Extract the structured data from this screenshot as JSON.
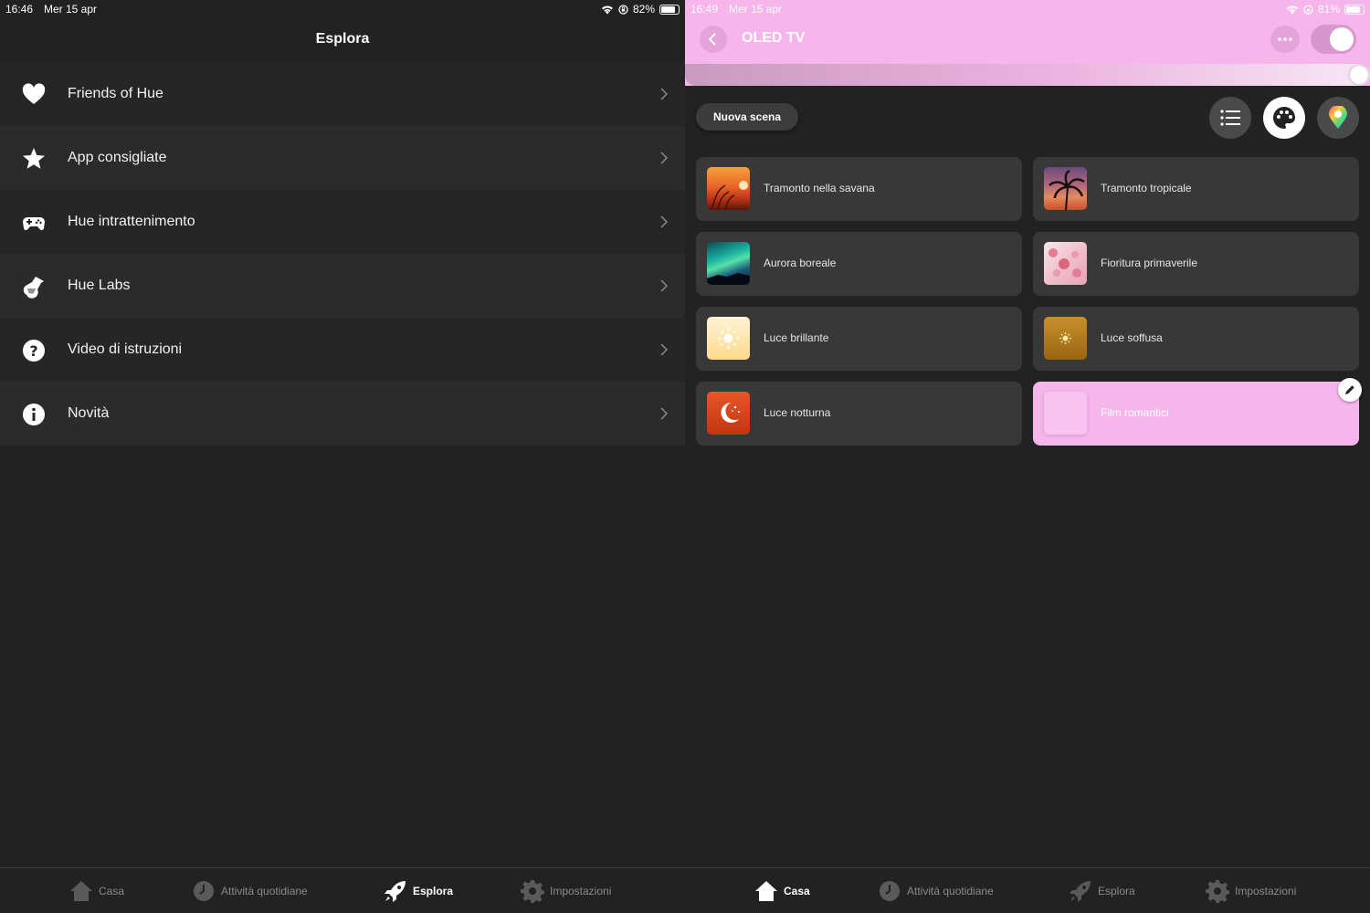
{
  "left": {
    "status": {
      "time": "16:46",
      "date": "Mer 15 apr",
      "battery": "82%",
      "battery_level": 0.82
    },
    "title": "Esplora",
    "menu": [
      {
        "label": "Friends of Hue",
        "icon": "heart-icon"
      },
      {
        "label": "App consigliate",
        "icon": "star-icon"
      },
      {
        "label": "Hue intrattenimento",
        "icon": "gamepad-icon"
      },
      {
        "label": "Hue Labs",
        "icon": "flask-icon"
      },
      {
        "label": "Video di istruzioni",
        "icon": "question-icon"
      },
      {
        "label": "Novità",
        "icon": "info-icon"
      }
    ],
    "tabs": [
      {
        "label": "Casa",
        "icon": "home-icon",
        "active": false
      },
      {
        "label": "Attività quotidiane",
        "icon": "clock-icon",
        "active": false
      },
      {
        "label": "Esplora",
        "icon": "rocket-icon",
        "active": true
      },
      {
        "label": "Impostazioni",
        "icon": "gear-icon",
        "active": false
      }
    ]
  },
  "right": {
    "status": {
      "time": "16:49",
      "date": "Mer 15 apr",
      "battery": "81%",
      "battery_level": 0.81
    },
    "room_title": "OLED TV",
    "toggle_on": true,
    "brightness": 1.0,
    "accent_color": "#f6b6ec",
    "new_scene_label": "Nuova scena",
    "view_buttons": [
      {
        "icon": "list-icon",
        "active": false
      },
      {
        "icon": "palette-icon",
        "active": true
      },
      {
        "icon": "color-picker-icon",
        "active": false
      }
    ],
    "scenes": [
      {
        "name": "Tramonto nella savana",
        "thumb": "savanna-sunset"
      },
      {
        "name": "Tramonto tropicale",
        "thumb": "tropical-sunset"
      },
      {
        "name": "Aurora boreale",
        "thumb": "aurora"
      },
      {
        "name": "Fioritura primaverile",
        "thumb": "spring-blossom"
      },
      {
        "name": "Luce brillante",
        "thumb": "bright-light"
      },
      {
        "name": "Luce soffusa",
        "thumb": "soft-light"
      },
      {
        "name": "Luce notturna",
        "thumb": "night-light"
      },
      {
        "name": "Film romantici",
        "thumb": "romantic-film",
        "selected": true
      }
    ],
    "tabs": [
      {
        "label": "Casa",
        "icon": "home-icon",
        "active": true
      },
      {
        "label": "Attività quotidiane",
        "icon": "clock-icon",
        "active": false
      },
      {
        "label": "Esplora",
        "icon": "rocket-icon",
        "active": false
      },
      {
        "label": "Impostazioni",
        "icon": "gear-icon",
        "active": false
      }
    ]
  }
}
